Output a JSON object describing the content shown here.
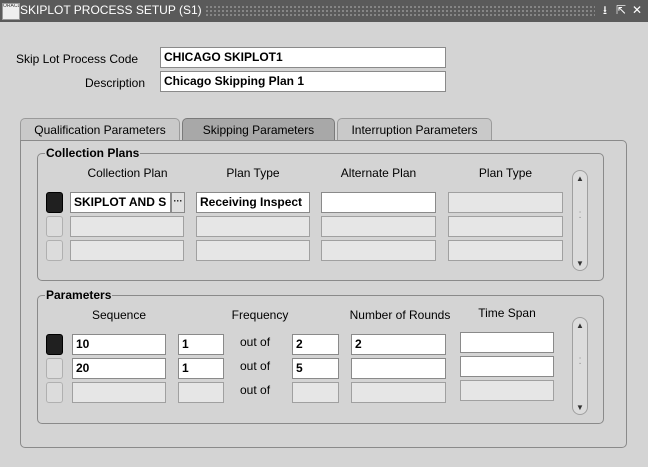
{
  "window": {
    "title": "SKIPLOT PROCESS SETUP (S1)",
    "icon_text": "ORACLE",
    "controls": [
      "⭳",
      "⇱",
      "✕"
    ]
  },
  "header": {
    "code_label": "Skip Lot Process Code",
    "code_value": "CHICAGO SKIPLOT1",
    "desc_label": "Description",
    "desc_value": "Chicago Skipping Plan 1"
  },
  "tabs": [
    {
      "label": "Qualification Parameters",
      "active": false
    },
    {
      "label": "Skipping Parameters",
      "active": true
    },
    {
      "label": "Interruption Parameters",
      "active": false
    }
  ],
  "collection_plans": {
    "title": "Collection Plans",
    "columns": [
      "Collection Plan",
      "Plan Type",
      "Alternate Plan",
      "Plan Type"
    ],
    "lov_glyph": "···",
    "rows": [
      {
        "plan": "SKIPLOT AND S",
        "type": "Receiving Inspect",
        "alt": "",
        "alt_type": ""
      },
      {
        "plan": "",
        "type": "",
        "alt": "",
        "alt_type": ""
      },
      {
        "plan": "",
        "type": "",
        "alt": "",
        "alt_type": ""
      }
    ]
  },
  "parameters": {
    "title": "Parameters",
    "columns": [
      "Sequence",
      "Frequency",
      "Number of Rounds",
      "Time Span"
    ],
    "out_of_label": "out of",
    "rows": [
      {
        "sequence": "10",
        "freq_a": "1",
        "freq_b": "2",
        "rounds": "2",
        "span": ""
      },
      {
        "sequence": "20",
        "freq_a": "1",
        "freq_b": "5",
        "rounds": "",
        "span": ""
      },
      {
        "sequence": "",
        "freq_a": "",
        "freq_b": "",
        "rounds": "",
        "span": ""
      }
    ]
  },
  "scrollbar": {
    "up": "▲",
    "down": "▼",
    "grip": "⁚"
  }
}
